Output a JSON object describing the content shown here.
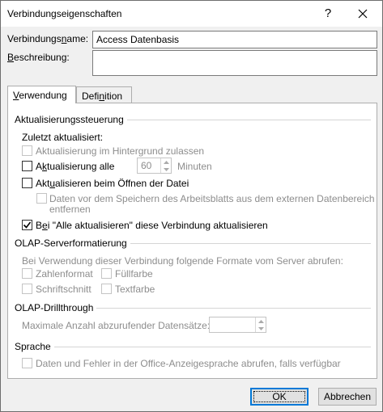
{
  "window": {
    "title": "Verbindungseigenschaften",
    "help_label": "?",
    "close_icon": "close-icon"
  },
  "connection": {
    "name_label_pre": "Verbindungs",
    "name_label_u": "n",
    "name_label_post": "ame:",
    "name_value": "Access Datenbasis",
    "desc_label_u": "B",
    "desc_label_post": "eschreibung:",
    "desc_value": ""
  },
  "tabs": [
    {
      "label_u": "V",
      "label_post": "erwendung",
      "active": true
    },
    {
      "label_pre": "Defi",
      "label_u": "n",
      "label_post": "ition",
      "active": false
    }
  ],
  "refresh": {
    "group_title": "Aktualisierungssteuerung",
    "last_updated_label": "Zuletzt aktualisiert:",
    "background_label": "Aktualisierung im Hintergrund zulassen",
    "background_checked": false,
    "background_enabled": false,
    "every_label_pre": "A",
    "every_label_u": "k",
    "every_label_post": "tualisierung alle",
    "every_checked": false,
    "every_minutes": "60",
    "minutes_label": "Minuten",
    "onopen_label_pre": "Akt",
    "onopen_label_u": "u",
    "onopen_label_post": "alisieren beim Öffnen der Datei",
    "onopen_checked": false,
    "remove_data_label_1": "Daten vor dem Speichern des Arbeitsblatts aus dem externen Datenbereich",
    "remove_data_label_2": "entfernen",
    "remove_data_checked": false,
    "remove_data_enabled": false,
    "refresh_all_label_pre": "B",
    "refresh_all_label_u": "e",
    "refresh_all_label_post": "i \"Alle aktualisieren\" diese Verbindung aktualisieren",
    "refresh_all_checked": true
  },
  "olap_format": {
    "group_title": "OLAP-Serverformatierung",
    "intro": "Bei Verwendung dieser Verbindung folgende Formate vom Server abrufen:",
    "number_format": "Zahlenformat",
    "fill_color": "Füllfarbe",
    "font_style": "Schriftschnitt",
    "text_color": "Textfarbe"
  },
  "olap_drill": {
    "group_title": "OLAP-Drillthrough",
    "max_records_label": "Maximale Anzahl abzurufender Datensätze:",
    "max_records_value": ""
  },
  "language": {
    "group_title": "Sprache",
    "office_lang_label": "Daten und Fehler in der Office-Anzeigesprache abrufen, falls verfügbar"
  },
  "buttons": {
    "ok": "OK",
    "cancel": "Abbrechen"
  },
  "colors": {
    "accent": "#0078d7",
    "disabled_text": "#8d8d8d",
    "background": "#f0f0f0"
  }
}
